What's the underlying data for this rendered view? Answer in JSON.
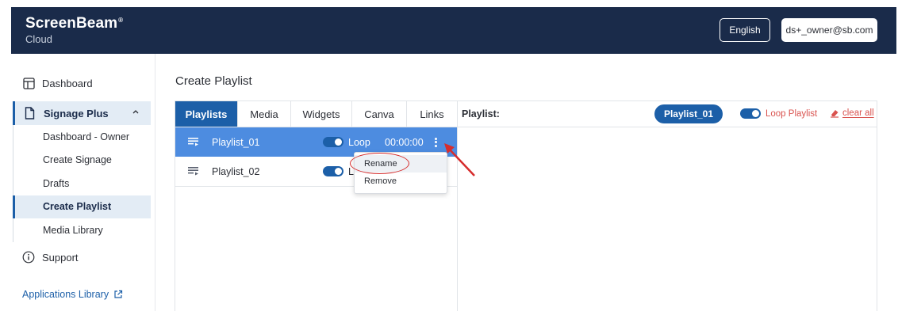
{
  "header": {
    "brand_name": "ScreenBeam",
    "brand_mark": "®",
    "brand_sub": "Cloud",
    "language": "English",
    "user": "ds+_owner@sb.com",
    "bg_color": "#1a2b4a"
  },
  "sidebar": {
    "dashboard": "Dashboard",
    "group_label": "Signage Plus",
    "sub_items": [
      "Dashboard - Owner",
      "Create Signage",
      "Drafts",
      "Create Playlist",
      "Media Library"
    ],
    "active_item": "Create Playlist",
    "support": "Support",
    "apps_library": "Applications Library"
  },
  "main": {
    "title": "Create Playlist",
    "tabs": [
      "Playlists",
      "Media",
      "Widgets",
      "Canva",
      "Links"
    ],
    "active_tab": "Playlists",
    "playlists": [
      {
        "name": "Playlist_01",
        "loop_label": "Loop",
        "loop_on": true,
        "duration": "00:00:00",
        "selected": true
      },
      {
        "name": "Playlist_02",
        "loop_label": "Lo",
        "loop_on": true,
        "duration": "",
        "selected": false
      }
    ],
    "context_menu": {
      "rename": "Rename",
      "remove": "Remove"
    },
    "right_panel": {
      "label": "Playlist:",
      "current_playlist": "Playlist_01",
      "loop_playlist": "Loop Playlist",
      "loop_playlist_on": true,
      "clear_all": "clear all"
    },
    "accent_color": "#1c5fa8",
    "selected_row_color": "#4d8ce0",
    "annotation_color": "#d62d2d"
  }
}
